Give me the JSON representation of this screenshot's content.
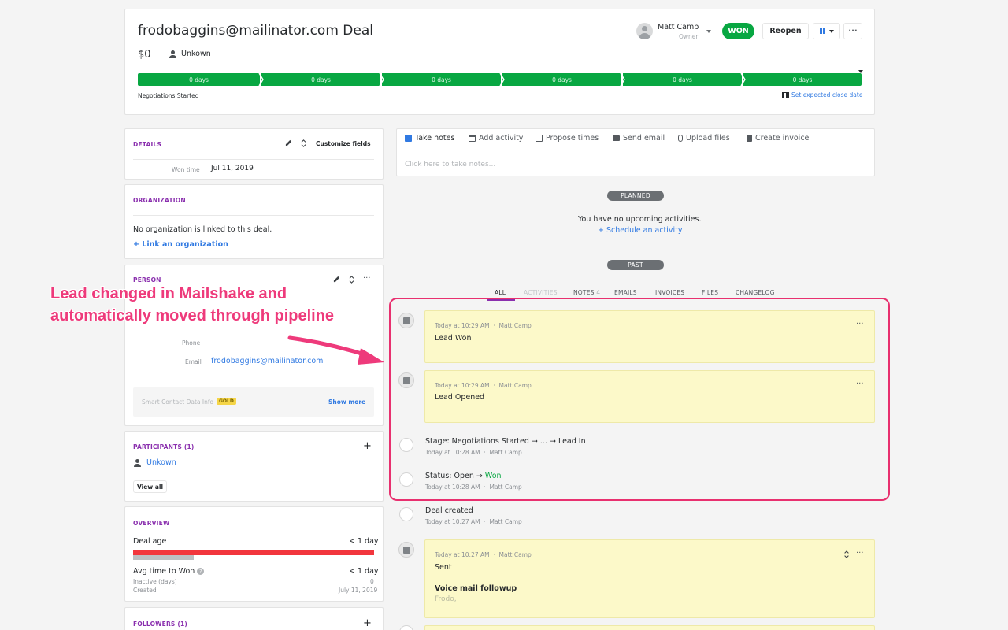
{
  "header": {
    "title": "frodobaggins@mailinator.com Deal",
    "value": "$0",
    "contact": "Unkown",
    "owner_name": "Matt Camp",
    "owner_role": "Owner",
    "status": "WON",
    "reopen": "Reopen",
    "stages": [
      "0 days",
      "0 days",
      "0 days",
      "0 days",
      "0 days",
      "0 days"
    ],
    "stage_label": "Negotiations Started",
    "close_date_link": "Set expected close date"
  },
  "details": {
    "title": "DETAILS",
    "customize": "Customize fields",
    "won_time_label": "Won time",
    "won_time_value": "Jul 11, 2019"
  },
  "organization": {
    "title": "ORGANIZATION",
    "empty": "No organization is linked to this deal.",
    "link": "+ Link an organization"
  },
  "person": {
    "title": "PERSON",
    "phone_label": "Phone",
    "email_label": "Email",
    "email_value": "frodobaggins@mailinator.com",
    "smart_label": "Smart Contact Data Info",
    "smart_badge": "GOLD",
    "show_more": "Show more"
  },
  "participants": {
    "title": "PARTICIPANTS (1)",
    "name": "Unkown",
    "view_all": "View all"
  },
  "overview": {
    "title": "OVERVIEW",
    "deal_age_label": "Deal age",
    "deal_age_value": "< 1 day",
    "deal_age_fill": 1.0,
    "avg_label": "Avg time to Won",
    "avg_value": "< 1 day",
    "inactive_label": "Inactive (days)",
    "inactive_value": "0",
    "created_label": "Created",
    "created_value": "July 11, 2019"
  },
  "followers": {
    "title": "FOLLOWERS (1)"
  },
  "toolbar": {
    "take_notes": "Take notes",
    "add_activity": "Add activity",
    "propose_times": "Propose times",
    "send_email": "Send email",
    "upload_files": "Upload files",
    "create_invoice": "Create invoice",
    "notes_placeholder": "Click here to take notes..."
  },
  "planned": {
    "pill": "PLANNED",
    "empty": "You have no upcoming activities.",
    "schedule": "+ Schedule an activity"
  },
  "past": {
    "pill": "PAST",
    "tabs": {
      "all": "ALL",
      "activities": "ACTIVITIES",
      "notes": "NOTES",
      "notes_count": "4",
      "emails": "EMAILS",
      "invoices": "INVOICES",
      "files": "FILES",
      "changelog": "CHANGELOG"
    }
  },
  "timeline": {
    "note1": {
      "time": "Today at 10:29 AM",
      "author": "Matt Camp",
      "text": "Lead Won"
    },
    "note2": {
      "time": "Today at 10:29 AM",
      "author": "Matt Camp",
      "text": "Lead Opened"
    },
    "stage": {
      "text": "Stage: Negotiations Started → ... → Lead In",
      "time": "Today at 10:28 AM",
      "author": "Matt Camp"
    },
    "status": {
      "prefix": "Status: Open → ",
      "won": "Won",
      "time": "Today at 10:28 AM",
      "author": "Matt Camp"
    },
    "created": {
      "text": "Deal created",
      "time": "Today at 10:27 AM",
      "author": "Matt Camp"
    },
    "note3": {
      "time": "Today at 10:27 AM",
      "author": "Matt Camp",
      "text": "Sent",
      "subject": "Voice mail followup",
      "body": "Frodo,"
    }
  },
  "annotation": {
    "line1": "Lead changed in Mailshake and",
    "line2": "automatically moved through pipeline"
  },
  "colors": {
    "accent_green": "#08a742",
    "highlight_pink": "#e8306f",
    "section_purple": "#8a2fae",
    "link_blue": "#317ae2",
    "note_yellow": "#fcf9c9"
  }
}
